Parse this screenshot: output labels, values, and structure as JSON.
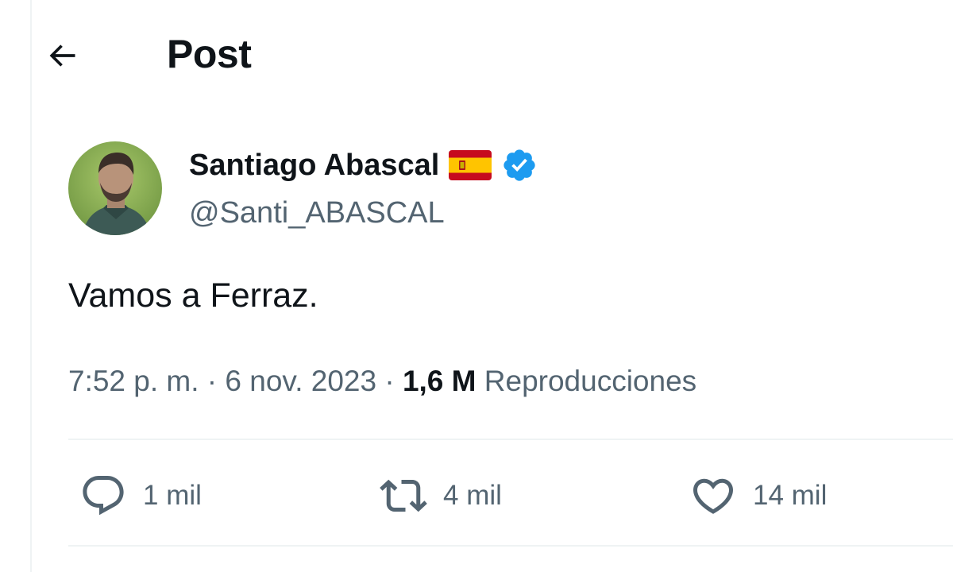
{
  "header": {
    "title": "Post"
  },
  "post": {
    "author": {
      "display_name": "Santiago Abascal",
      "handle": "@Santi_ABASCAL",
      "flag_icon": "spain-flag-icon",
      "verified_icon": "verified-badge-icon"
    },
    "text": "Vamos a Ferraz.",
    "meta": {
      "time": "7:52 p. m.",
      "separator": " · ",
      "date": "6 nov. 2023",
      "views_count": "1,6 M",
      "views_label": "Reproducciones"
    },
    "actions": {
      "replies": "1 mil",
      "reposts": "4 mil",
      "likes": "14 mil"
    }
  },
  "colors": {
    "text_primary": "#0f1419",
    "text_secondary": "#536471",
    "verified_blue": "#1d9bf0",
    "divider": "#eff3f4",
    "flag_red": "#c60b1e",
    "flag_yellow": "#ffc400"
  }
}
